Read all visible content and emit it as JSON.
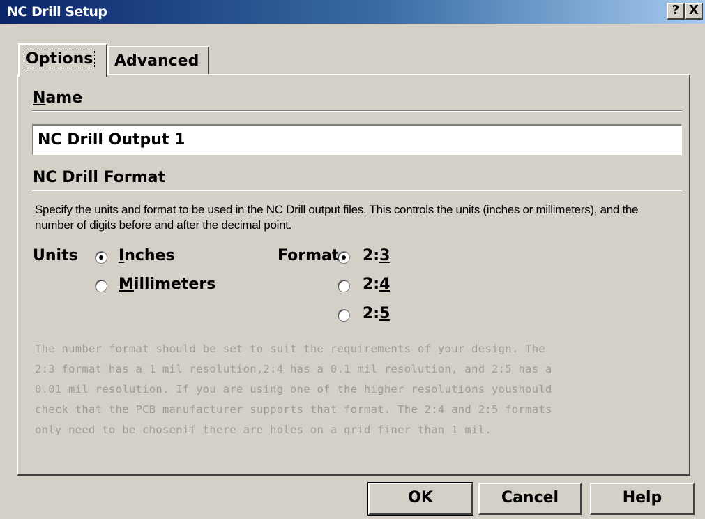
{
  "window": {
    "title": "NC Drill Setup",
    "help_glyph": "?",
    "close_glyph": "X"
  },
  "tabs": [
    {
      "label": "Options",
      "active": true
    },
    {
      "label": "Advanced",
      "active": false
    }
  ],
  "name_section": {
    "heading_first": "N",
    "heading_rest": "ame",
    "value": "NC Drill Output 1"
  },
  "format_section": {
    "heading": "NC Drill Format",
    "description": "Specify the units and format to be used in the NC Drill output files. This controls the units (inches or millimeters), and the number of digits before and after the decimal point.",
    "units_label": "Units",
    "units_options": [
      {
        "first": "I",
        "rest": "nches",
        "selected": true
      },
      {
        "first": "M",
        "rest": "illimeters",
        "selected": false
      }
    ],
    "format_label": "Format",
    "format_options": [
      {
        "prefix": "2:",
        "digit": "3",
        "selected": true
      },
      {
        "prefix": "2:",
        "digit": "4",
        "selected": false
      },
      {
        "prefix": "2:",
        "digit": "5",
        "selected": false
      }
    ],
    "note_lines": [
      "The number format should be set to suit the requirements of your design. The",
      "2:3 format has a 1 mil resolution,2:4 has a 0.1 mil resolution, and 2:5 has a",
      "0.01 mil resolution. If you are using one of the higher resolutions youshould",
      "check that the PCB manufacturer supports that format. The 2:4 and 2:5 formats",
      "only need to be chosenif there are holes on a grid finer than 1 mil."
    ]
  },
  "buttons": {
    "ok": "OK",
    "cancel": "Cancel",
    "help": "Help"
  }
}
